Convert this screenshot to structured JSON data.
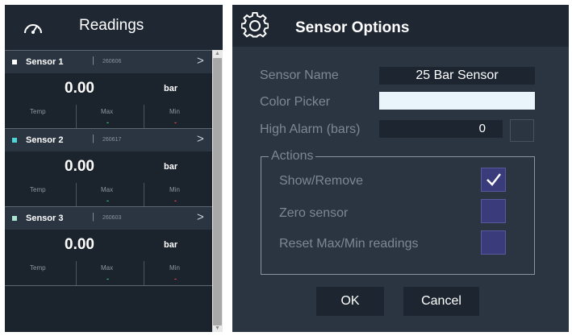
{
  "readings": {
    "title": "Readings",
    "icon": "gauge-icon",
    "sensors": [
      {
        "name": "Sensor 1",
        "id": "260606",
        "value": "0.00",
        "unit": "bar",
        "indicator_color": "#ffffff",
        "labels": {
          "temp": "Temp",
          "max": "Max",
          "min": "Min"
        },
        "max_dash": "-",
        "min_dash": "-"
      },
      {
        "name": "Sensor 2",
        "id": "260617",
        "value": "0.00",
        "unit": "bar",
        "indicator_color": "#4dd6d6",
        "labels": {
          "temp": "Temp",
          "max": "Max",
          "min": "Min"
        },
        "max_dash": "-",
        "min_dash": "-"
      },
      {
        "name": "Sensor 3",
        "id": "260603",
        "value": "0.00",
        "unit": "bar",
        "indicator_color": "#a8e6cf",
        "labels": {
          "temp": "Temp",
          "max": "Max",
          "min": "Min"
        },
        "max_dash": "-",
        "min_dash": "-"
      }
    ],
    "separator": "|",
    "arrow": ">",
    "max_color": "#3cc46a",
    "min_color": "#e04848"
  },
  "options": {
    "title": "Sensor Options",
    "icon": "gear-icon",
    "sensor_name_label": "Sensor Name",
    "sensor_name_value": "25 Bar Sensor",
    "color_picker_label": "Color Picker",
    "color_value": "#eaf4fb",
    "high_alarm_label": "High Alarm (bars)",
    "high_alarm_value": "0",
    "actions": {
      "legend": "Actions",
      "items": [
        {
          "label": "Show/Remove",
          "checked": true
        },
        {
          "label": "Zero sensor",
          "checked": false
        },
        {
          "label": "Reset Max/Min readings",
          "checked": false
        }
      ]
    },
    "ok_label": "OK",
    "cancel_label": "Cancel"
  }
}
